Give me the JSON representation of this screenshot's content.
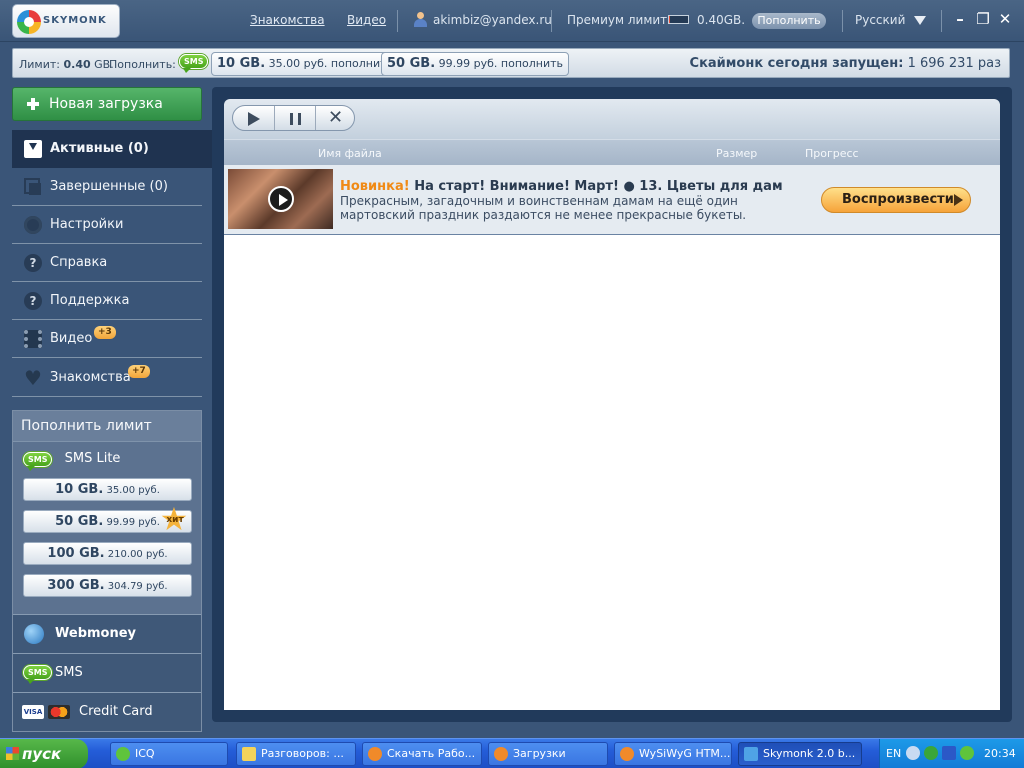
{
  "titlebar": {
    "logo": "SKYMONK",
    "links": {
      "dating": "Знакомства",
      "video": "Видео"
    },
    "user_email": "akimbiz@yandex.ru",
    "premium_label": "Премиум лимит",
    "premium_value": "0.40GB.",
    "premium_level_percent": 4,
    "topup_button": "Пополнить",
    "language": "Русский",
    "controls": {
      "minimize": "–",
      "restore": "❐",
      "close": "✕"
    }
  },
  "infobar": {
    "limit_label": "Лимит:",
    "limit_value": "0.40",
    "limit_unit": "GB.",
    "topup_label": "Пополнить:",
    "sms_badge": "SMS",
    "offers": [
      {
        "size": "10 GB.",
        "price": "35.00 руб.",
        "action": "пополнить"
      },
      {
        "size": "50 GB.",
        "price": "99.99 руб.",
        "action": "пополнить"
      }
    ],
    "launch_label": "Скаймонк сегодня запущен:",
    "launch_value": "1 696 231 раз"
  },
  "sidebar": {
    "new_download": "Новая загрузка",
    "items": [
      {
        "label": "Активные (0)",
        "icon": "inbox-icon"
      },
      {
        "label": "Завершенные (0)",
        "icon": "copy-icon"
      },
      {
        "label": "Настройки",
        "icon": "gear-icon"
      },
      {
        "label": "Справка",
        "icon": "help-icon"
      },
      {
        "label": "Поддержка",
        "icon": "help-icon"
      },
      {
        "label": "Видео",
        "icon": "film-icon",
        "badge": "+3"
      },
      {
        "label": "Знакомства",
        "icon": "heart-icon",
        "badge": "+7"
      }
    ]
  },
  "refill": {
    "title": "Пополнить лимит",
    "sms_lite": "SMS Lite",
    "sms_badge": "SMS",
    "packages": [
      {
        "size": "10 GB.",
        "price": "35.00 руб."
      },
      {
        "size": "50 GB.",
        "price": "99.99 руб."
      },
      {
        "size": "100 GB.",
        "price": "210.00 руб."
      },
      {
        "size": "300 GB.",
        "price": "304.79 руб."
      }
    ],
    "hit_label": "хит",
    "payments": {
      "webmoney": "Webmoney",
      "sms": "SMS",
      "credit_card": "Credit Card",
      "visa": "VISA"
    }
  },
  "downloads": {
    "columns": {
      "name": "Имя файла",
      "size": "Размер",
      "progress": "Прогресс"
    },
    "promo": {
      "tag": "Новинка!",
      "title": "На старт! Внимание! Март! ● 13. Цветы для дам",
      "description": "Прекрасным, загадочным и воинственнам дамам на ещё один мартовский праздник раздаются не менее прекрасные букеты.",
      "watch_button": "Воспроизвести"
    }
  },
  "taskbar": {
    "start": "пуск",
    "tasks": [
      "ICQ",
      "Разговоров: ...",
      "Скачать Рабо...",
      "Загрузки",
      "WySiWyG HTM...",
      "Skymonk 2.0 b..."
    ],
    "lang": "EN",
    "clock": "20:34"
  }
}
